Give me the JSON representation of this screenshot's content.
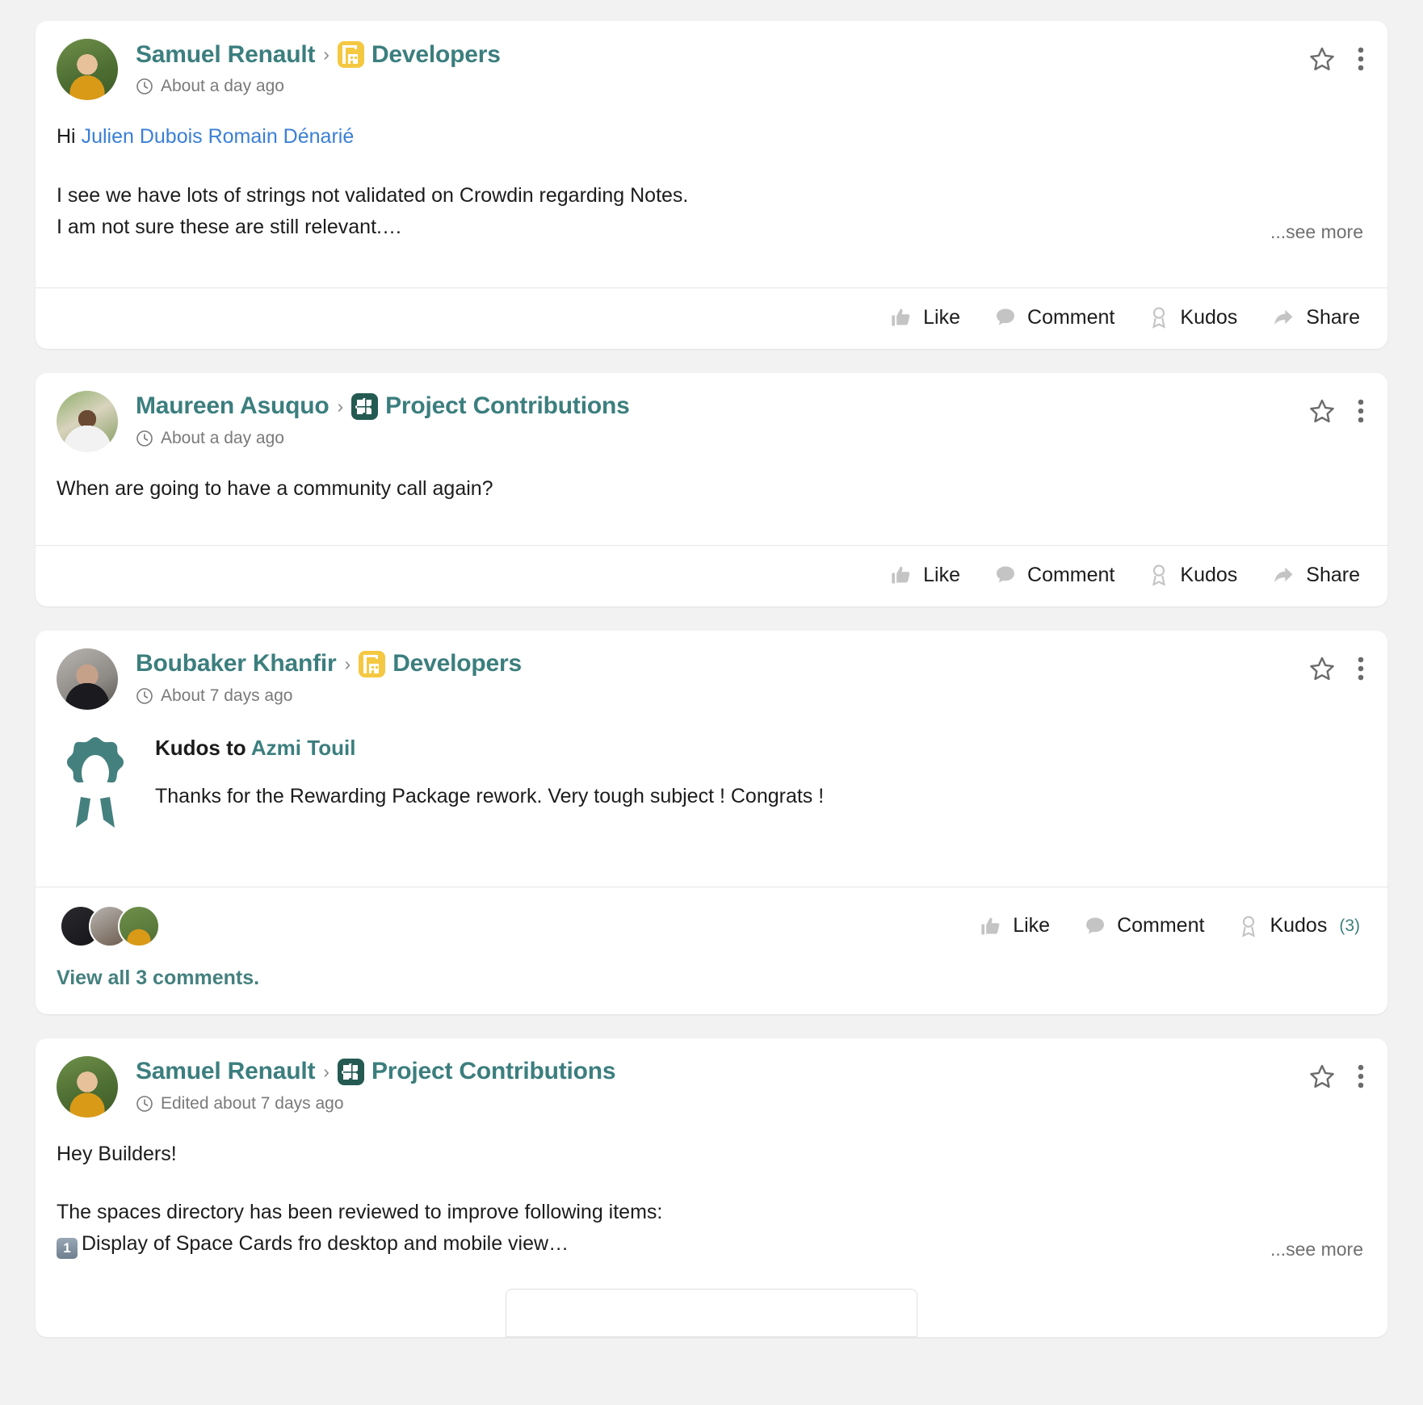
{
  "colors": {
    "accent_teal": "#3c7e7e",
    "link_blue": "#3a7fd5",
    "page_bg": "#f2f2f2",
    "card_bg": "#ffffff",
    "muted_text": "#7a7a7a",
    "developers_space": "#f5c842",
    "contributions_space": "#245a52"
  },
  "actions": {
    "like": "Like",
    "comment": "Comment",
    "kudos": "Kudos",
    "share": "Share",
    "see_more": "...see more"
  },
  "icons": {
    "clock": "clock-icon",
    "star": "star-icon",
    "more": "more-vertical-icon",
    "thumbs_up": "thumbs-up-icon",
    "speech_bubble": "speech-bubble-icon",
    "award": "award-icon",
    "share_arrow": "share-arrow-icon"
  },
  "posts": [
    {
      "author": "Samuel Renault",
      "separator": "›",
      "space": "Developers",
      "space_icon": "crane-building-icon",
      "timestamp": "About a day ago",
      "body_line1_prefix": "Hi ",
      "body_mention": "Julien Dubois Romain Dénarié",
      "body_line2": "I see we have lots of strings not validated on Crowdin regarding Notes.",
      "body_line3": "I am not sure these are still relevant.…",
      "truncated": true,
      "footer": {
        "like": "Like",
        "comment": "Comment",
        "kudos": "Kudos",
        "share": "Share"
      }
    },
    {
      "author": "Maureen Asuquo",
      "separator": "›",
      "space": "Project Contributions",
      "space_icon": "puzzle-piece-icon",
      "timestamp": "About a day ago",
      "body_line1": "When are going to have a community call again?",
      "truncated": false,
      "footer": {
        "like": "Like",
        "comment": "Comment",
        "kudos": "Kudos",
        "share": "Share"
      }
    },
    {
      "author": "Boubaker Khanfir",
      "separator": "›",
      "space": "Developers",
      "space_icon": "crane-building-icon",
      "timestamp": "About 7 days ago",
      "kudos_label": "Kudos to ",
      "kudos_target": "Azmi Touil",
      "kudos_message": "Thanks for the Rewarding Package rework. Very tough subject ! Congrats !",
      "footer": {
        "like": "Like",
        "comment": "Comment",
        "kudos": "Kudos",
        "kudos_count": "(3)"
      },
      "comments_link": "View all 3 comments."
    },
    {
      "author": "Samuel Renault",
      "separator": "›",
      "space": "Project Contributions",
      "space_icon": "puzzle-piece-icon",
      "timestamp": "Edited about 7 days ago",
      "body_line1": "Hey Builders!",
      "body_line2": "The spaces directory has been reviewed to improve following items:",
      "body_item_number": "1",
      "body_item_text": "Display of Space Cards fro desktop and mobile view…",
      "truncated": true
    }
  ]
}
